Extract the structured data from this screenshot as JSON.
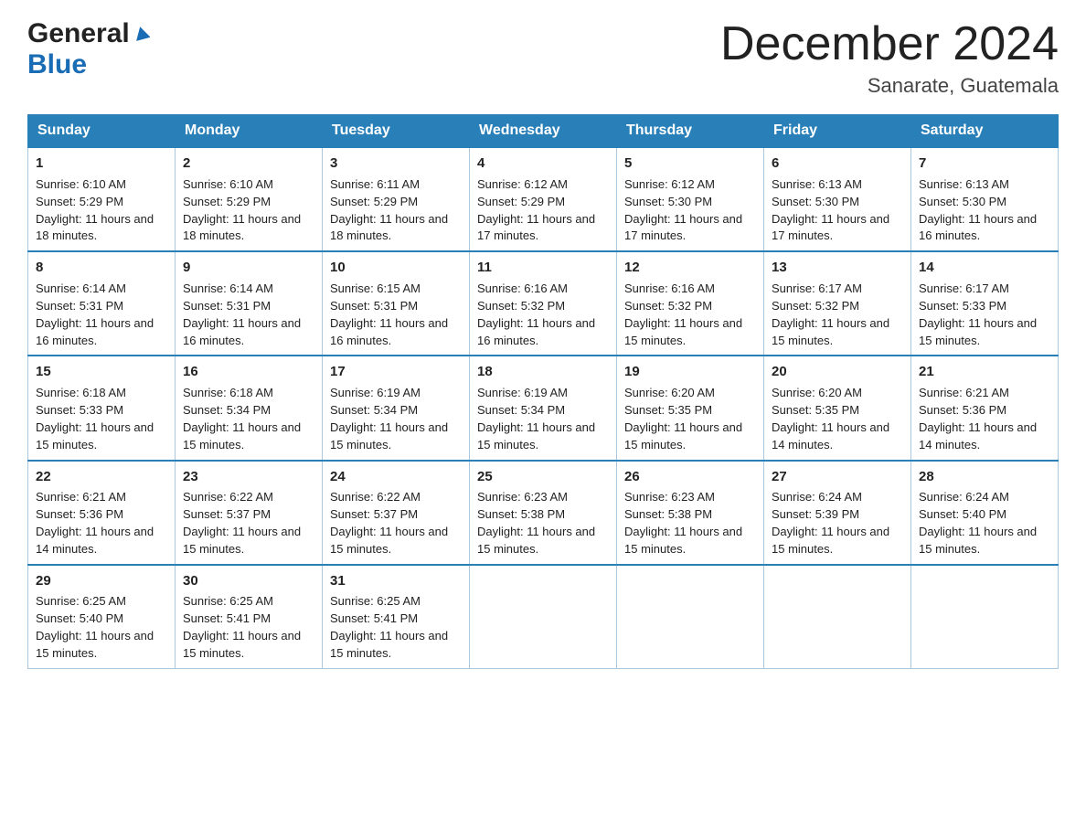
{
  "header": {
    "logo_general": "General",
    "logo_blue": "Blue",
    "month_title": "December 2024",
    "location": "Sanarate, Guatemala"
  },
  "days": [
    "Sunday",
    "Monday",
    "Tuesday",
    "Wednesday",
    "Thursday",
    "Friday",
    "Saturday"
  ],
  "weeks": [
    [
      {
        "num": "1",
        "sunrise": "6:10 AM",
        "sunset": "5:29 PM",
        "daylight": "11 hours and 18 minutes."
      },
      {
        "num": "2",
        "sunrise": "6:10 AM",
        "sunset": "5:29 PM",
        "daylight": "11 hours and 18 minutes."
      },
      {
        "num": "3",
        "sunrise": "6:11 AM",
        "sunset": "5:29 PM",
        "daylight": "11 hours and 18 minutes."
      },
      {
        "num": "4",
        "sunrise": "6:12 AM",
        "sunset": "5:29 PM",
        "daylight": "11 hours and 17 minutes."
      },
      {
        "num": "5",
        "sunrise": "6:12 AM",
        "sunset": "5:30 PM",
        "daylight": "11 hours and 17 minutes."
      },
      {
        "num": "6",
        "sunrise": "6:13 AM",
        "sunset": "5:30 PM",
        "daylight": "11 hours and 17 minutes."
      },
      {
        "num": "7",
        "sunrise": "6:13 AM",
        "sunset": "5:30 PM",
        "daylight": "11 hours and 16 minutes."
      }
    ],
    [
      {
        "num": "8",
        "sunrise": "6:14 AM",
        "sunset": "5:31 PM",
        "daylight": "11 hours and 16 minutes."
      },
      {
        "num": "9",
        "sunrise": "6:14 AM",
        "sunset": "5:31 PM",
        "daylight": "11 hours and 16 minutes."
      },
      {
        "num": "10",
        "sunrise": "6:15 AM",
        "sunset": "5:31 PM",
        "daylight": "11 hours and 16 minutes."
      },
      {
        "num": "11",
        "sunrise": "6:16 AM",
        "sunset": "5:32 PM",
        "daylight": "11 hours and 16 minutes."
      },
      {
        "num": "12",
        "sunrise": "6:16 AM",
        "sunset": "5:32 PM",
        "daylight": "11 hours and 15 minutes."
      },
      {
        "num": "13",
        "sunrise": "6:17 AM",
        "sunset": "5:32 PM",
        "daylight": "11 hours and 15 minutes."
      },
      {
        "num": "14",
        "sunrise": "6:17 AM",
        "sunset": "5:33 PM",
        "daylight": "11 hours and 15 minutes."
      }
    ],
    [
      {
        "num": "15",
        "sunrise": "6:18 AM",
        "sunset": "5:33 PM",
        "daylight": "11 hours and 15 minutes."
      },
      {
        "num": "16",
        "sunrise": "6:18 AM",
        "sunset": "5:34 PM",
        "daylight": "11 hours and 15 minutes."
      },
      {
        "num": "17",
        "sunrise": "6:19 AM",
        "sunset": "5:34 PM",
        "daylight": "11 hours and 15 minutes."
      },
      {
        "num": "18",
        "sunrise": "6:19 AM",
        "sunset": "5:34 PM",
        "daylight": "11 hours and 15 minutes."
      },
      {
        "num": "19",
        "sunrise": "6:20 AM",
        "sunset": "5:35 PM",
        "daylight": "11 hours and 15 minutes."
      },
      {
        "num": "20",
        "sunrise": "6:20 AM",
        "sunset": "5:35 PM",
        "daylight": "11 hours and 14 minutes."
      },
      {
        "num": "21",
        "sunrise": "6:21 AM",
        "sunset": "5:36 PM",
        "daylight": "11 hours and 14 minutes."
      }
    ],
    [
      {
        "num": "22",
        "sunrise": "6:21 AM",
        "sunset": "5:36 PM",
        "daylight": "11 hours and 14 minutes."
      },
      {
        "num": "23",
        "sunrise": "6:22 AM",
        "sunset": "5:37 PM",
        "daylight": "11 hours and 15 minutes."
      },
      {
        "num": "24",
        "sunrise": "6:22 AM",
        "sunset": "5:37 PM",
        "daylight": "11 hours and 15 minutes."
      },
      {
        "num": "25",
        "sunrise": "6:23 AM",
        "sunset": "5:38 PM",
        "daylight": "11 hours and 15 minutes."
      },
      {
        "num": "26",
        "sunrise": "6:23 AM",
        "sunset": "5:38 PM",
        "daylight": "11 hours and 15 minutes."
      },
      {
        "num": "27",
        "sunrise": "6:24 AM",
        "sunset": "5:39 PM",
        "daylight": "11 hours and 15 minutes."
      },
      {
        "num": "28",
        "sunrise": "6:24 AM",
        "sunset": "5:40 PM",
        "daylight": "11 hours and 15 minutes."
      }
    ],
    [
      {
        "num": "29",
        "sunrise": "6:25 AM",
        "sunset": "5:40 PM",
        "daylight": "11 hours and 15 minutes."
      },
      {
        "num": "30",
        "sunrise": "6:25 AM",
        "sunset": "5:41 PM",
        "daylight": "11 hours and 15 minutes."
      },
      {
        "num": "31",
        "sunrise": "6:25 AM",
        "sunset": "5:41 PM",
        "daylight": "11 hours and 15 minutes."
      },
      null,
      null,
      null,
      null
    ]
  ],
  "labels": {
    "sunrise_prefix": "Sunrise: ",
    "sunset_prefix": "Sunset: ",
    "daylight_prefix": "Daylight: "
  }
}
